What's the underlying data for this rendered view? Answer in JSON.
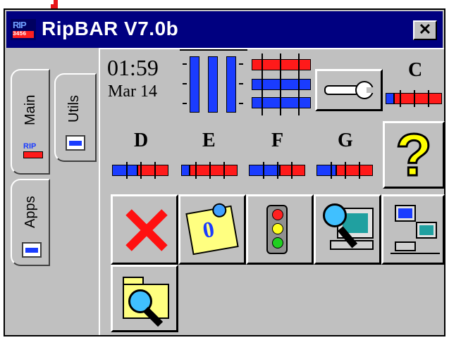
{
  "window": {
    "title": "RipBAR V7.0b",
    "close_glyph": "✕",
    "app_icon_text": "RIP",
    "app_icon_sub": "3456"
  },
  "tabs": [
    {
      "label": "Main",
      "icon": "rip-icon",
      "selected": true
    },
    {
      "label": "Utils",
      "icon": "folder-icon"
    },
    {
      "label": "Apps",
      "icon": "folder-icon"
    }
  ],
  "status": {
    "time": "01:59",
    "date": "Mar 14"
  },
  "meters": {
    "memory_bars": 3,
    "resource_fill": [
      0.9,
      1.0,
      0.95
    ]
  },
  "drives": [
    {
      "label": "C",
      "used_fraction": 0.15
    },
    {
      "label": "D",
      "used_fraction": 0.45
    },
    {
      "label": "E",
      "used_fraction": 0.15
    },
    {
      "label": "F",
      "used_fraction": 0.55
    },
    {
      "label": "G",
      "used_fraction": 0.35
    }
  ],
  "buttons": [
    {
      "name": "settings-wrench-button",
      "icon": "wrench-icon"
    },
    {
      "name": "help-button",
      "icon": "question-icon",
      "glyph": "?"
    },
    {
      "name": "exit-button",
      "icon": "red-x-icon"
    },
    {
      "name": "notes-button",
      "icon": "sticky-note-icon",
      "glyph": "0"
    },
    {
      "name": "traffic-light-button",
      "icon": "traffic-light-icon"
    },
    {
      "name": "find-computer-button",
      "icon": "magnifier-computer-icon"
    },
    {
      "name": "network-button",
      "icon": "network-computers-icon"
    },
    {
      "name": "find-files-button",
      "icon": "folder-search-icon"
    }
  ],
  "colors": {
    "titlebar": "#000080",
    "used": "#ff1a1a",
    "free": "#1a3cff",
    "face": "#c0c0c0"
  }
}
